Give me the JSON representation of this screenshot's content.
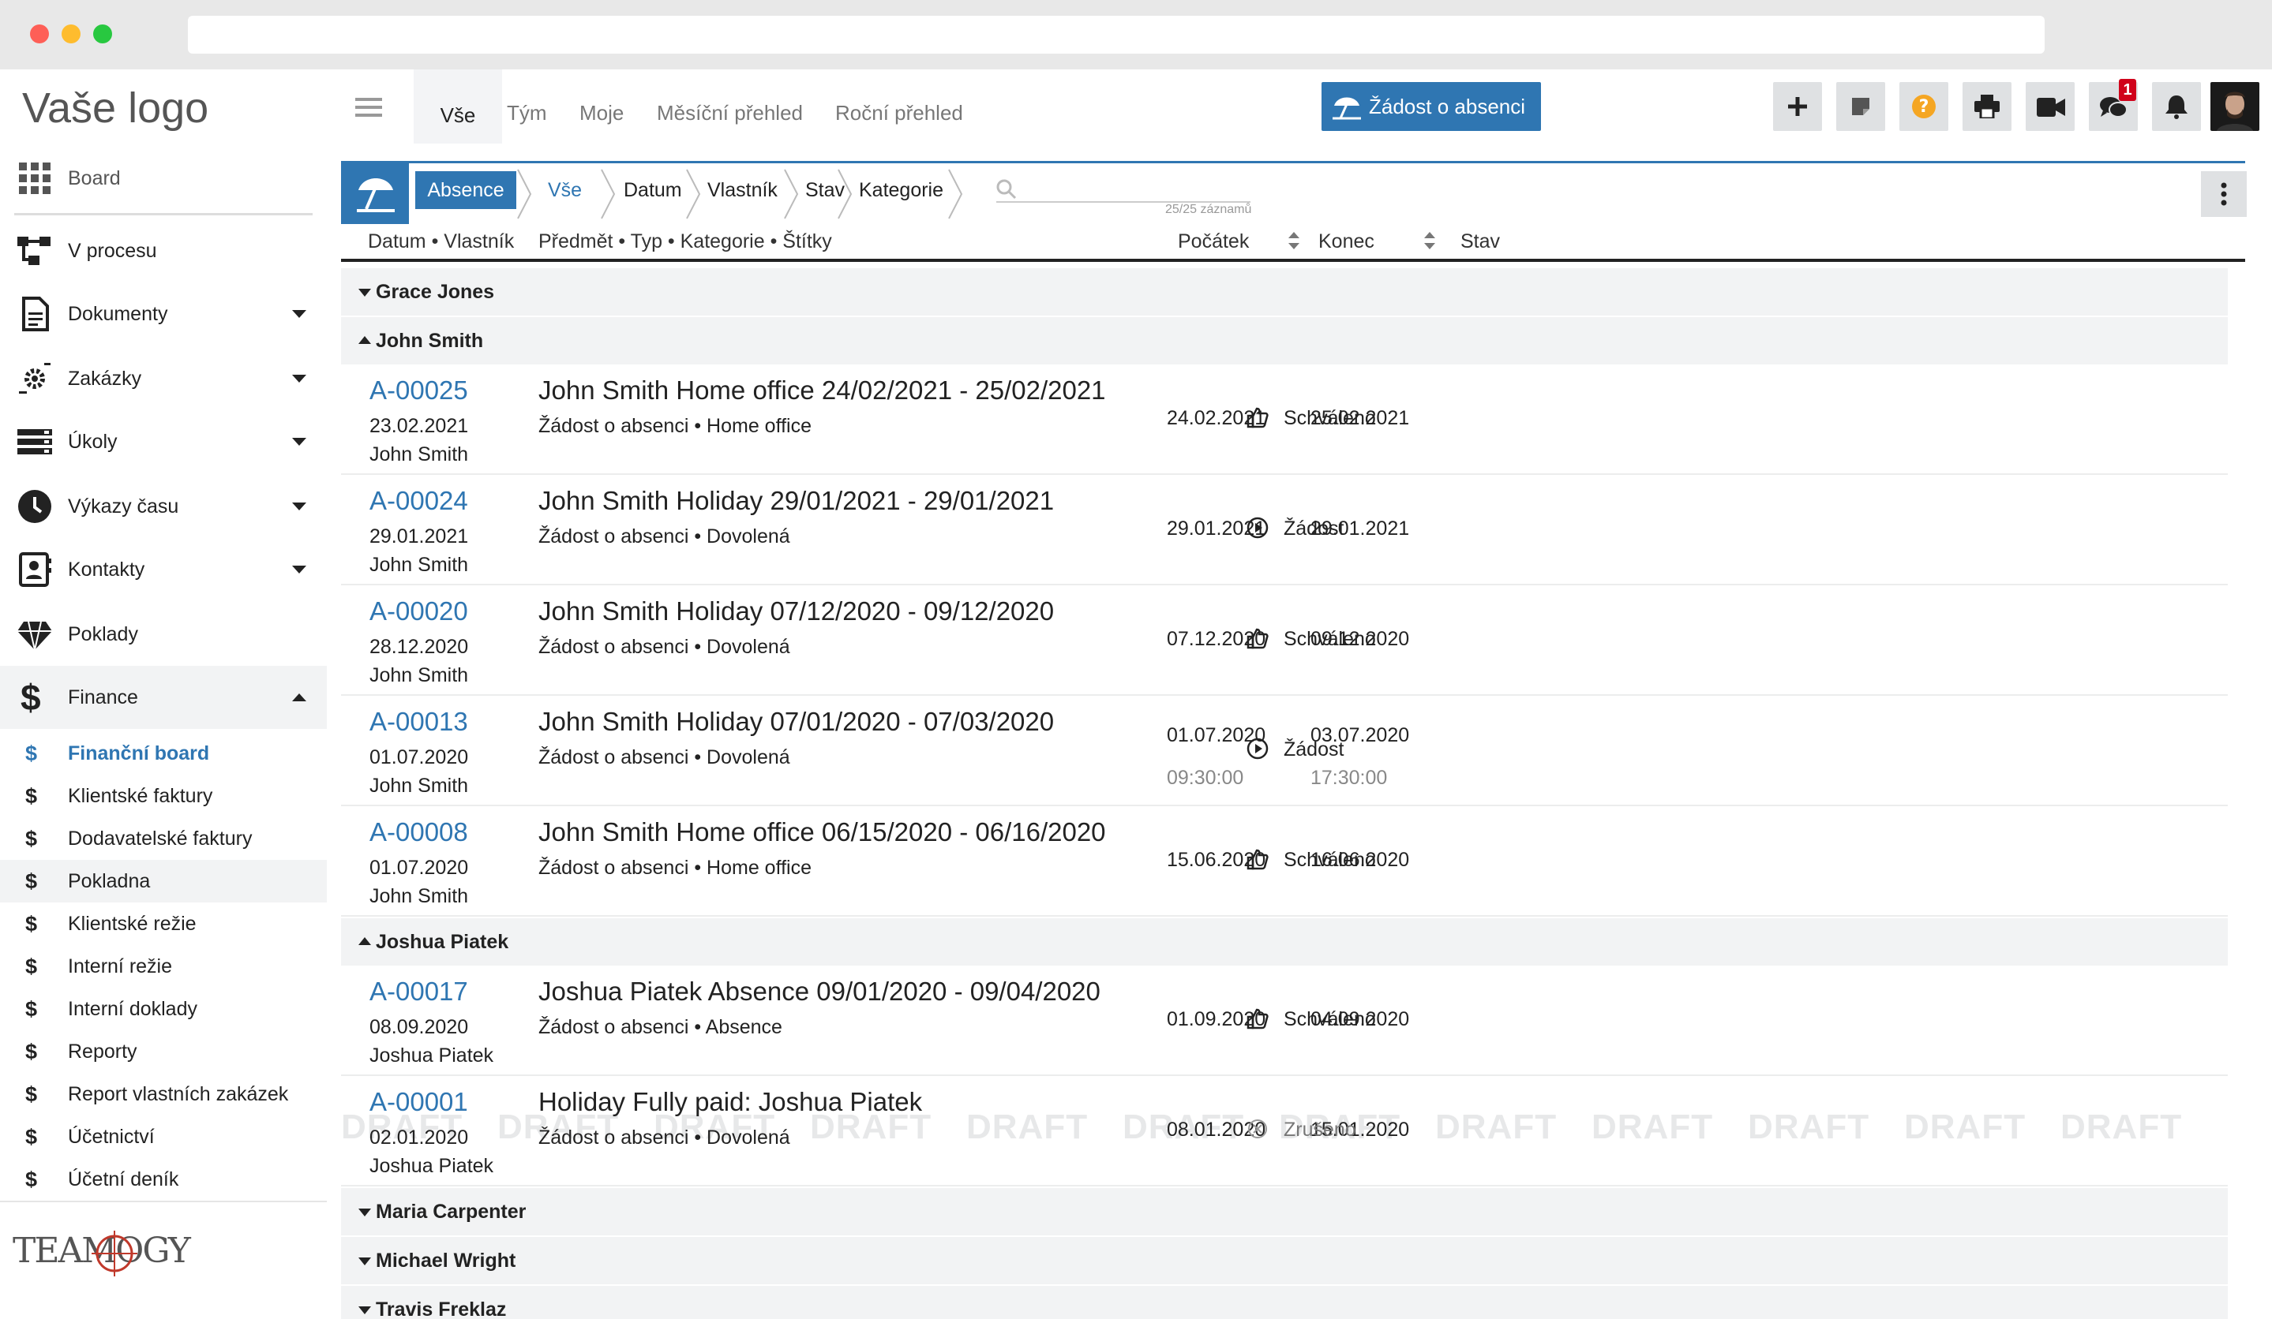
{
  "sidebar": {
    "logo": "Vaše logo",
    "items": [
      {
        "label": "Board",
        "icon": "grid-icon"
      },
      {
        "label": "V procesu",
        "icon": "workflow-icon"
      },
      {
        "label": "Dokumenty",
        "icon": "document-icon"
      },
      {
        "label": "Zakázky",
        "icon": "gears-icon"
      },
      {
        "label": "Úkoly",
        "icon": "tasks-icon"
      },
      {
        "label": "Výkazy času",
        "icon": "clock-icon"
      },
      {
        "label": "Kontakty",
        "icon": "contact-book-icon"
      },
      {
        "label": "Poklady",
        "icon": "diamond-icon"
      },
      {
        "label": "Finance",
        "icon": "dollar-icon"
      }
    ],
    "finance_sub": [
      {
        "label": "Finanční board"
      },
      {
        "label": "Klientské faktury"
      },
      {
        "label": "Dodavatelské faktury"
      },
      {
        "label": "Pokladna"
      },
      {
        "label": "Klientské režie"
      },
      {
        "label": "Interní režie"
      },
      {
        "label": "Interní doklady"
      },
      {
        "label": "Reporty"
      },
      {
        "label": "Report vlastních zakázek"
      },
      {
        "label": "Účetnictví"
      },
      {
        "label": "Účetní deník"
      }
    ],
    "sub_symbol": "$",
    "brand": "TEAMOGY"
  },
  "topnav": {
    "tabs": [
      "Vše",
      "Tým",
      "Moje",
      "Měsíční přehled",
      "Roční přehled"
    ],
    "absence_button": "Žádost o absenci",
    "chat_badge": "1",
    "toolbar_icons": [
      "plus-icon",
      "note-icon",
      "help-icon",
      "print-icon",
      "video-icon",
      "chat-icon",
      "bell-icon",
      "avatar"
    ]
  },
  "filter": {
    "crumbs": [
      "Absence",
      "Vše",
      "Datum",
      "Vlastník",
      "Stav",
      "Kategorie"
    ],
    "count": "25/25 záznamů"
  },
  "columns": {
    "left": "Datum • Vlastník",
    "middle": "Předmět • Typ • Kategorie • Štítky",
    "start": "Počátek",
    "end": "Konec",
    "state": "Stav"
  },
  "groups": {
    "grace": "Grace Jones",
    "john": "John Smith",
    "joshua": "Joshua Piatek",
    "maria": "Maria Carpenter",
    "michael": "Michael Wright",
    "travis": "Travis Freklaz"
  },
  "records": [
    {
      "id": "A-00025",
      "date": "23.02.2021",
      "owner": "John Smith",
      "title": "John Smith Home office 24/02/2021 - 25/02/2021",
      "sub": "Žádost o absenci • Home office",
      "start": "24.02.2021",
      "end": "25.02.2021",
      "state": "Schváleno"
    },
    {
      "id": "A-00024",
      "date": "29.01.2021",
      "owner": "John Smith",
      "title": "John Smith Holiday 29/01/2021 - 29/01/2021",
      "sub": "Žádost o absenci • Dovolená",
      "start": "29.01.2021",
      "end": "29.01.2021",
      "state": "Žádost"
    },
    {
      "id": "A-00020",
      "date": "28.12.2020",
      "owner": "John Smith",
      "title": "John Smith Holiday 07/12/2020 - 09/12/2020",
      "sub": "Žádost o absenci • Dovolená",
      "start": "07.12.2020",
      "end": "09.12.2020",
      "state": "Schváleno"
    },
    {
      "id": "A-00013",
      "date": "01.07.2020",
      "owner": "John Smith",
      "title": "John Smith Holiday 07/01/2020 - 07/03/2020",
      "sub": "Žádost o absenci • Dovolená",
      "start": "01.07.2020",
      "start_time": "09:30:00",
      "end": "03.07.2020",
      "end_time": "17:30:00",
      "state": "Žádost"
    },
    {
      "id": "A-00008",
      "date": "01.07.2020",
      "owner": "John Smith",
      "title": "John Smith Home office 06/15/2020 - 06/16/2020",
      "sub": "Žádost o absenci • Home office",
      "start": "15.06.2020",
      "end": "16.06.2020",
      "state": "Schváleno"
    },
    {
      "id": "A-00017",
      "date": "08.09.2020",
      "owner": "Joshua Piatek",
      "title": "Joshua Piatek Absence 09/01/2020 - 09/04/2020",
      "sub": "Žádost o absenci • Absence",
      "start": "01.09.2020",
      "end": "04.09.2020",
      "state": "Schváleno"
    },
    {
      "id": "A-00001",
      "date": "02.01.2020",
      "owner": "Joshua Piatek",
      "title": "Holiday Fully paid: Joshua Piatek",
      "sub": "Žádost o absenci • Dovolená",
      "start": "08.01.2020",
      "end": "15.01.2020",
      "state": "Zrušeno"
    }
  ],
  "watermark": "DRAFT",
  "colors": {
    "accent": "#2f76b2",
    "help": "#f5a623",
    "badge": "#d0021b"
  }
}
